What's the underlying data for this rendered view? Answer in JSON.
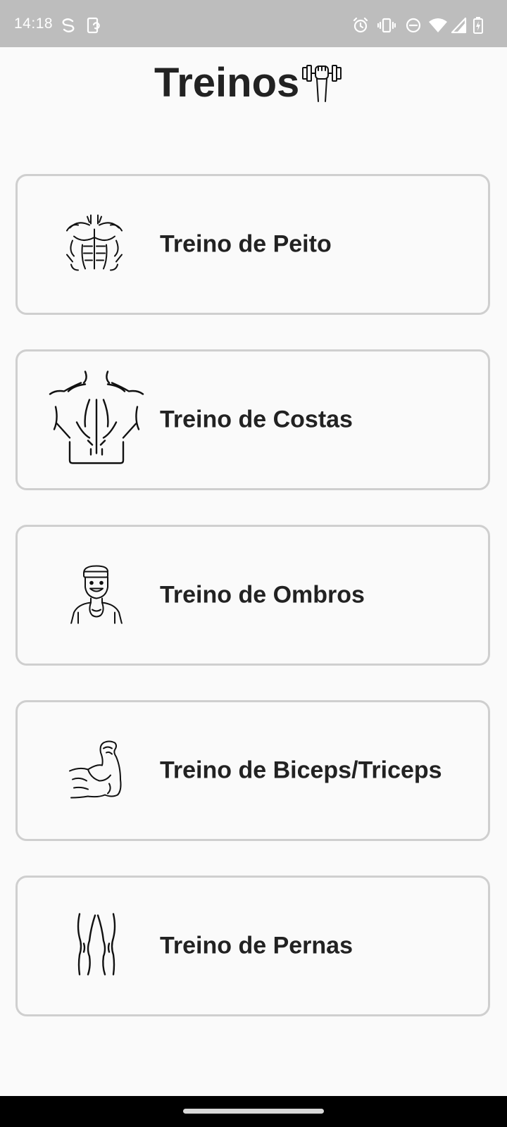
{
  "status_bar": {
    "time": "14:18",
    "left_icons": [
      "sync-icon",
      "screen-rotate-icon"
    ],
    "right_icons": [
      "alarm-icon",
      "vibrate-icon",
      "do-not-disturb-icon",
      "wifi-icon",
      "signal-icon",
      "battery-charging-icon"
    ],
    "background": "#bdbdbd"
  },
  "header": {
    "title": "Treinos",
    "icon": "weightlifting-dumbbell-icon"
  },
  "workouts": [
    {
      "label": "Treino de Peito",
      "icon": "chest-muscles-icon"
    },
    {
      "label": "Treino de Costas",
      "icon": "back-muscles-icon"
    },
    {
      "label": "Treino de Ombros",
      "icon": "shoulders-man-icon"
    },
    {
      "label": "Treino de Biceps/Triceps",
      "icon": "flexed-biceps-icon"
    },
    {
      "label": "Treino de Pernas",
      "icon": "legs-icon"
    }
  ],
  "colors": {
    "card_border": "#cfcfcf",
    "text": "#222222",
    "background": "#fafafa"
  }
}
